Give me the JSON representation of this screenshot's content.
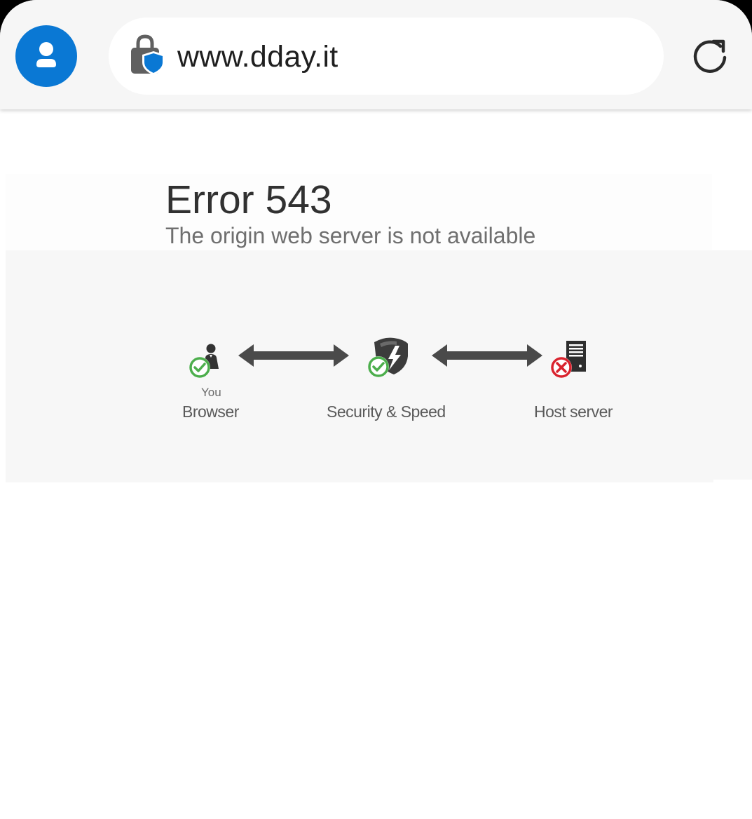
{
  "browser": {
    "url": "www.dday.it",
    "icons": {
      "profile": "profile-avatar-icon",
      "site_security": "lock-shield-icon",
      "reload": "reload-icon"
    },
    "colors": {
      "accent": "#0a78d4",
      "toolbar": "#f6f6f6"
    }
  },
  "page": {
    "error_title": "Error 543",
    "error_subtitle": "The origin web server is not available",
    "diagram": {
      "nodes": [
        {
          "sublabel": "You",
          "label": "Browser",
          "status": "ok",
          "icon": "user-icon"
        },
        {
          "label": "Security & Speed",
          "status": "ok",
          "icon": "shield-bolt-icon"
        },
        {
          "label": "Host server",
          "status": "error",
          "icon": "server-icon"
        }
      ],
      "colors": {
        "ok": "#4cae4c",
        "error": "#d9232e",
        "arrow": "#4a4a4a"
      }
    }
  }
}
